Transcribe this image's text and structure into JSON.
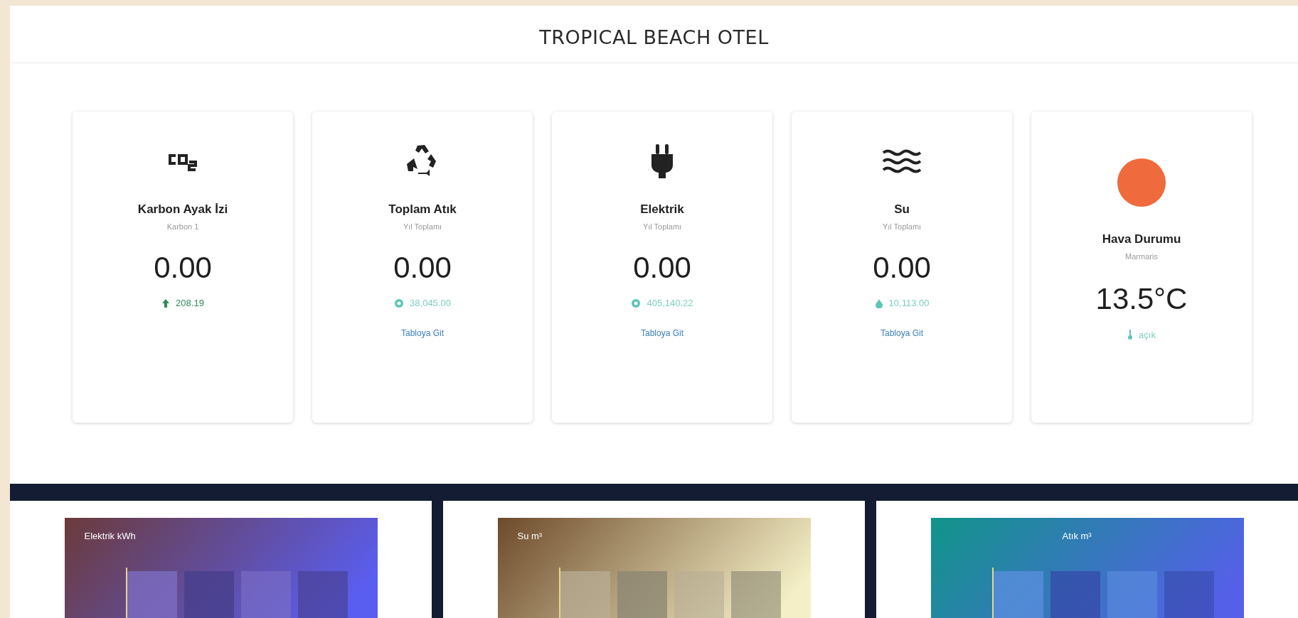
{
  "header": {
    "title": "TROPICAL BEACH OTEL"
  },
  "cards": [
    {
      "kind": "co2",
      "title": "Karbon Ayak İzi",
      "subtitle": "Karbon 1",
      "value": "0.00",
      "trend": {
        "kind": "up",
        "text": "208.19"
      }
    },
    {
      "kind": "recycle",
      "title": "Toplam Atık",
      "subtitle": "Yıl Toplamı",
      "value": "0.00",
      "trend": {
        "kind": "total",
        "text": "38,045.00"
      },
      "link": "Tabloya Git"
    },
    {
      "kind": "plug",
      "title": "Elektrik",
      "subtitle": "Yıl Toplamı",
      "value": "0.00",
      "trend": {
        "kind": "total",
        "text": "405,140.22"
      },
      "link": "Tabloya Git"
    },
    {
      "kind": "water",
      "title": "Su",
      "subtitle": "Yıl Toplamı",
      "value": "0.00",
      "trend": {
        "kind": "drop",
        "text": "10,113.00"
      },
      "link": "Tabloya Git"
    },
    {
      "kind": "sun",
      "title": "Hava Durumu",
      "subtitle": "Marmaris",
      "value": "13.5°C",
      "trend": {
        "kind": "thermo",
        "text": "açık"
      }
    }
  ],
  "panels": [
    {
      "title": "Elektrik kWh",
      "kind": "purple"
    },
    {
      "title": "Su m³",
      "kind": "sand"
    },
    {
      "title": "Atık m³",
      "kind": "teal"
    }
  ]
}
